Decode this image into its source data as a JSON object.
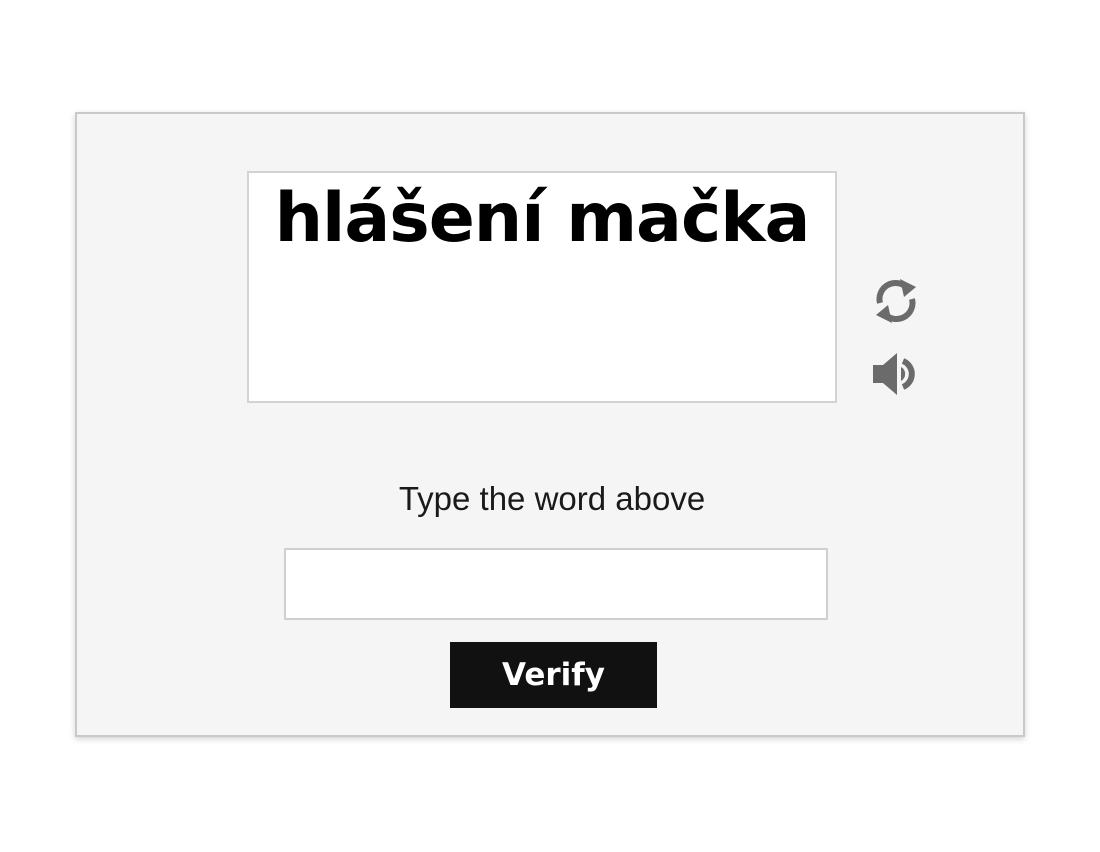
{
  "captcha": {
    "word": "hlášení mačka",
    "refresh_icon": "refresh-icon",
    "audio_icon": "speaker-icon",
    "icon_color": "#6b6b6b"
  },
  "form": {
    "prompt": "Type the word above",
    "input_value": "",
    "input_placeholder": "",
    "verify_label": "Verify"
  },
  "colors": {
    "panel_bg": "#f5f5f5",
    "button_bg": "#111111",
    "button_text": "#ffffff"
  }
}
